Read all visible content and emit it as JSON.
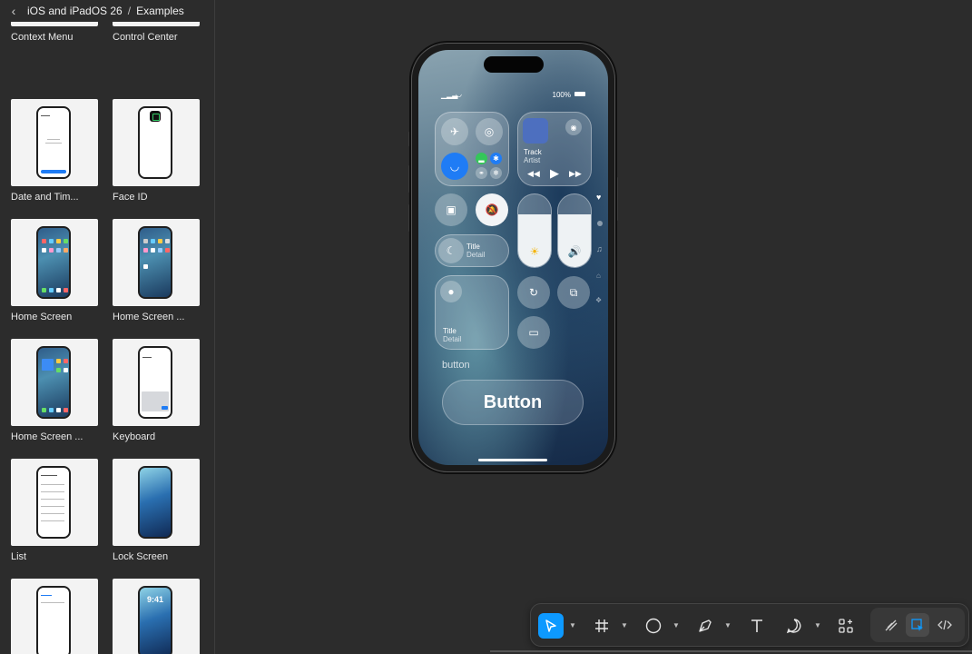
{
  "breadcrumb": {
    "parent": "iOS and iPadOS 26",
    "current": "Examples"
  },
  "sidebar": {
    "items": [
      {
        "label": "Context Menu"
      },
      {
        "label": "Control Center"
      },
      {
        "label": "Date and Tim..."
      },
      {
        "label": "Face ID"
      },
      {
        "label": "Home Screen"
      },
      {
        "label": "Home Screen ..."
      },
      {
        "label": "Home Screen ..."
      },
      {
        "label": "Keyboard"
      },
      {
        "label": "List"
      },
      {
        "label": "Lock Screen"
      },
      {
        "label": ""
      },
      {
        "label": ""
      }
    ]
  },
  "phone": {
    "battery": "100%",
    "media": {
      "track": "Track",
      "artist": "Artist"
    },
    "focus": {
      "title": "Title",
      "detail": "Detail"
    },
    "bigtile": {
      "title": "Title",
      "detail": "Detail"
    },
    "button_caption": "button",
    "button_label": "Button",
    "thumb_time": "9:41",
    "brightness_level": 0.72,
    "volume_level": 0.72
  },
  "colors": {
    "accent": "#0d99ff",
    "wifi_active": "#1f7cf5",
    "mute_icon": "#e5484d"
  },
  "toolbar": {
    "tools": [
      "move-tool",
      "frame-tool",
      "shape-tool",
      "pen-tool",
      "text-tool",
      "comment-tool",
      "actions-tool"
    ],
    "modes": [
      "draw-mode",
      "design-mode",
      "dev-mode"
    ]
  }
}
